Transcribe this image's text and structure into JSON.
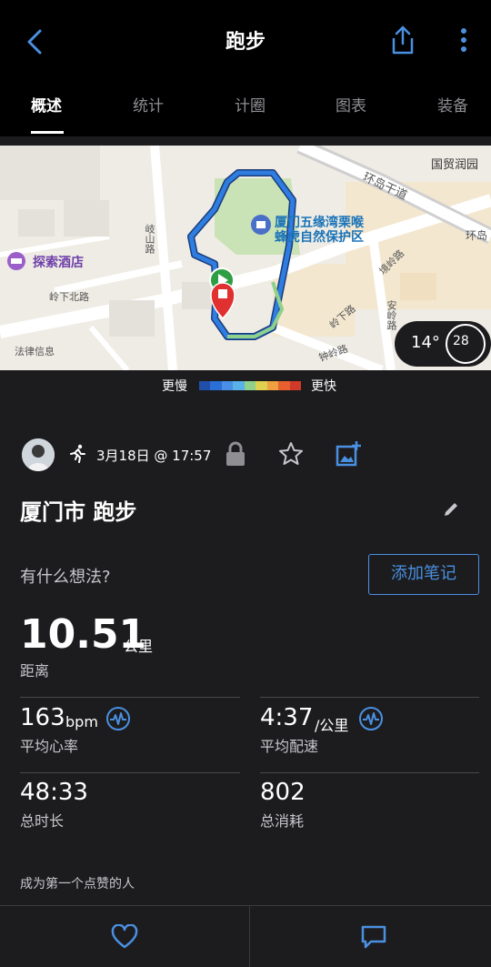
{
  "header": {
    "title": "跑步",
    "tabs": [
      {
        "label": "概述",
        "active": true
      },
      {
        "label": "统计"
      },
      {
        "label": "计圈"
      },
      {
        "label": "图表"
      },
      {
        "label": "装备"
      }
    ]
  },
  "map": {
    "pois": [
      "厦门五缘湾栗喉",
      "蜂虎自然保护区",
      "探索酒店",
      "国贸润园",
      "法律信息"
    ],
    "roads": [
      "环岛干道",
      "环岛",
      "岐山路",
      "岭下北路",
      "钟岭路",
      "安岭路",
      "岭下路",
      "境岭路"
    ],
    "temperature": "14°",
    "wind": "28",
    "legend_slow": "更慢",
    "legend_fast": "更快",
    "legend_colors": [
      "#1f4fa8",
      "#2a6fd6",
      "#4a8fe6",
      "#5ab0e8",
      "#8fd08a",
      "#e0d050",
      "#f0a040",
      "#e86030",
      "#d03a28"
    ]
  },
  "activity": {
    "date": "3月18日 @ 17:57",
    "name": "厦门市 跑步",
    "thoughts_prompt": "有什么想法?",
    "add_note_label": "添加笔记",
    "distance": {
      "value": "10.51",
      "unit": "公里",
      "label": "距离"
    },
    "avg_hr": {
      "value": "163",
      "unit": "bpm",
      "label": "平均心率"
    },
    "avg_pace": {
      "value": "4:37",
      "unit": "/公里",
      "label": "平均配速"
    },
    "duration": {
      "value": "48:33",
      "label": "总时长"
    },
    "calories": {
      "value": "802",
      "label": "总消耗"
    },
    "kudos_text": "成为第一个点赞的人"
  },
  "colors": {
    "accent": "#4a90e2",
    "background": "#1c1c1e",
    "topbar": "#000000"
  }
}
